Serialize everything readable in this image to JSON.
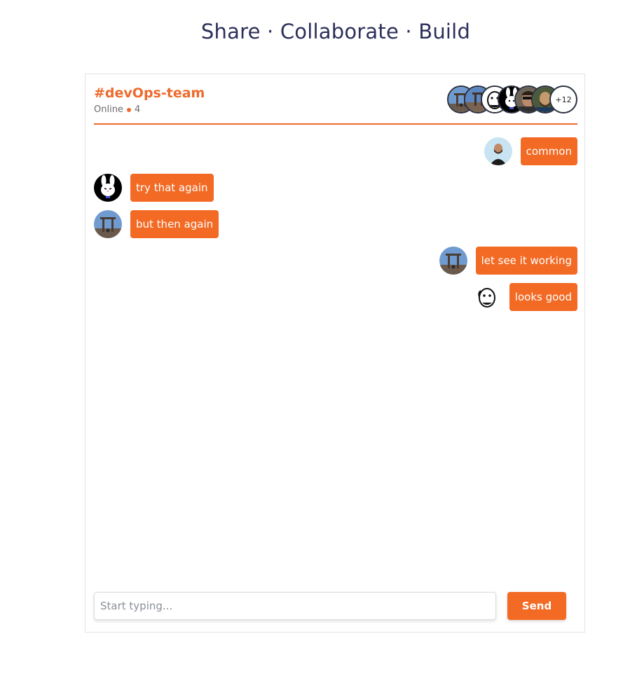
{
  "page": {
    "title": "Share · Collaborate · Build"
  },
  "chat": {
    "channel": "#devOps-team",
    "online_label": "Online",
    "online_count": "4",
    "more_members": "+12",
    "messages": [
      {
        "side": "right",
        "text": "common",
        "avatar": "man-with-beard-avatar"
      },
      {
        "side": "left",
        "text": "try that again",
        "avatar": "bunny-avatar"
      },
      {
        "side": "left",
        "text": "but then again",
        "avatar": "temple-gate-avatar"
      },
      {
        "side": "right",
        "text": "let see it working",
        "avatar": "temple-gate-avatar"
      },
      {
        "side": "right",
        "text": "looks good",
        "avatar": "cartoon-face-avatar"
      }
    ]
  },
  "composer": {
    "placeholder": "Start typing...",
    "send_label": "Send"
  },
  "colors": {
    "accent": "#f26a24",
    "title": "#2c2f5a"
  }
}
